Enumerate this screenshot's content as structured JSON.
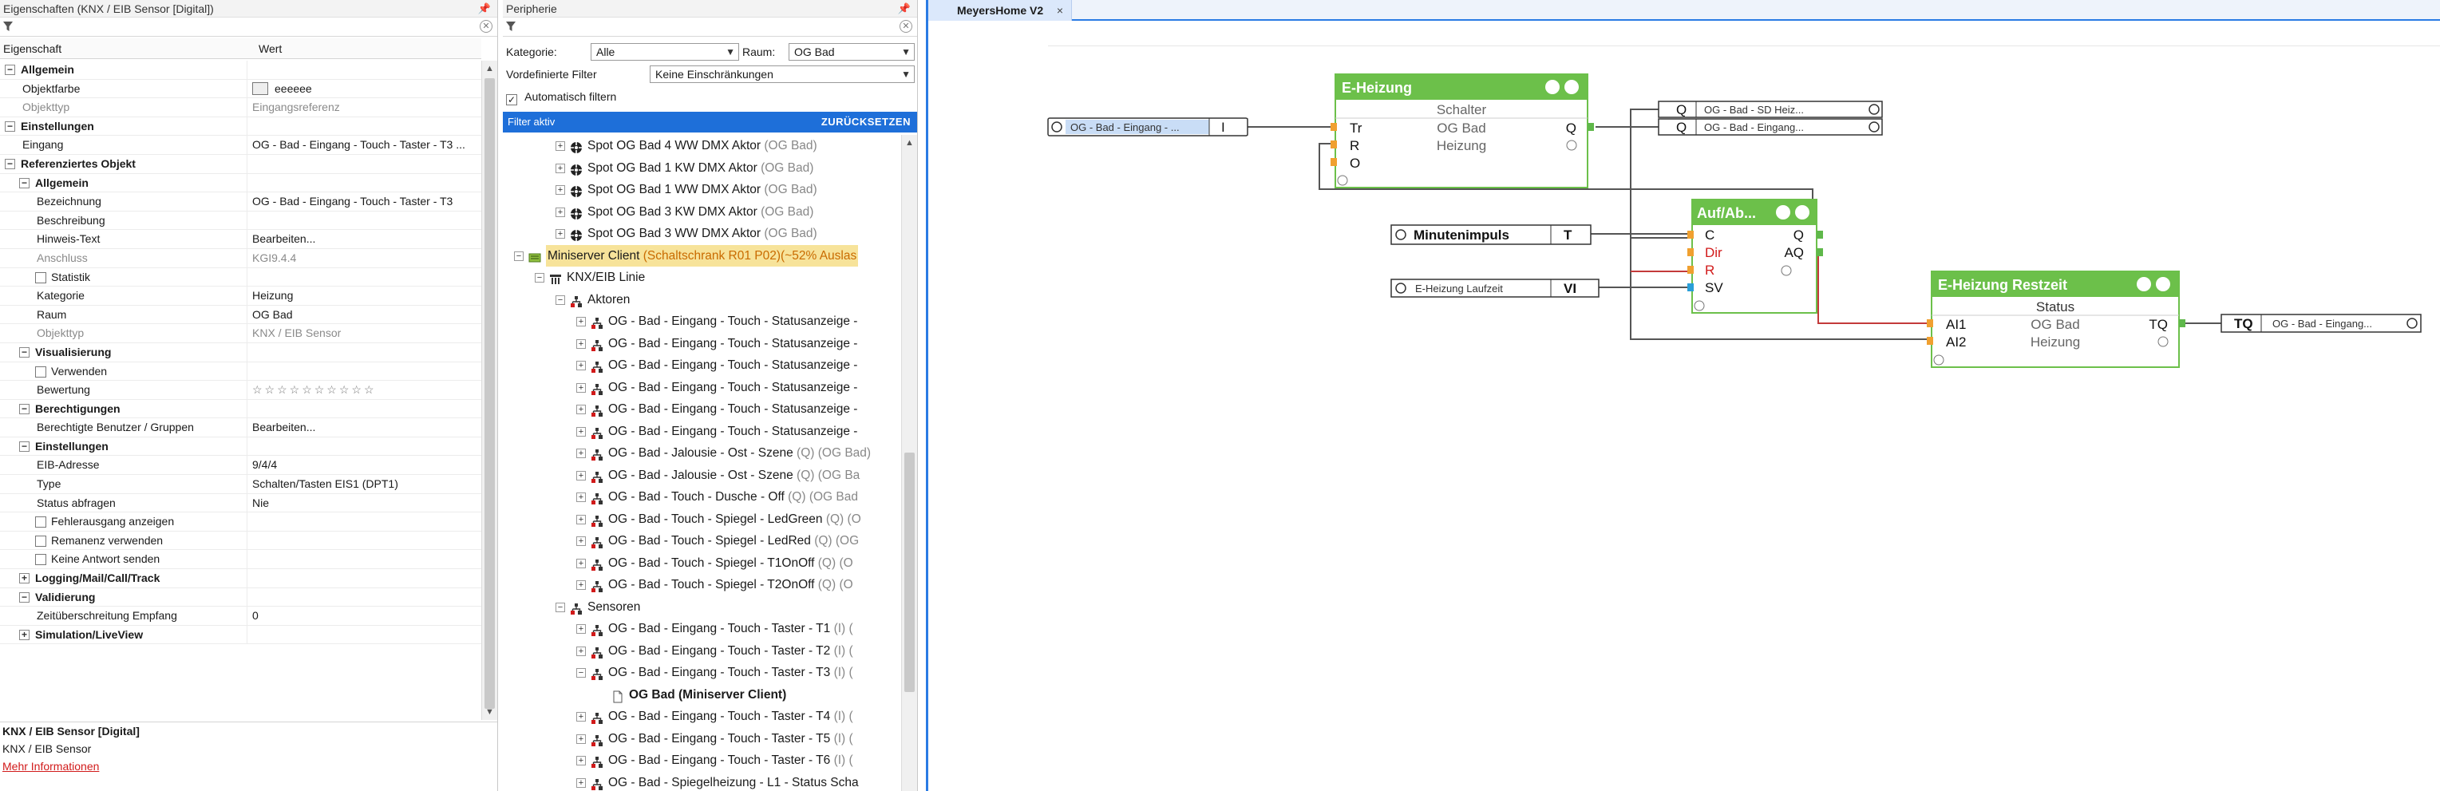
{
  "properties": {
    "title": "Eigenschaften (KNX / EIB Sensor [Digital])",
    "col_property": "Eigenschaft",
    "col_value": "Wert",
    "rows": [
      {
        "k": "Allgemein",
        "v": "",
        "level": 0,
        "cat": true,
        "toggle": "-"
      },
      {
        "k": "Objektfarbe",
        "v": "eeeeee",
        "level": 1,
        "swatch": true
      },
      {
        "k": "Objekttyp",
        "v": "Eingangsreferenz",
        "level": 1,
        "muted": true
      },
      {
        "k": "Einstellungen",
        "v": "",
        "level": 0,
        "cat": true,
        "toggle": "-"
      },
      {
        "k": "Eingang",
        "v": "OG - Bad - Eingang - Touch - Taster - T3 ...",
        "level": 1
      },
      {
        "k": "Referenziertes Objekt",
        "v": "",
        "level": 0,
        "cat": true,
        "toggle": "-"
      },
      {
        "k": "Allgemein",
        "v": "",
        "level": 1,
        "cat": true,
        "toggle": "-"
      },
      {
        "k": "Bezeichnung",
        "v": "OG - Bad - Eingang - Touch - Taster - T3",
        "level": 2
      },
      {
        "k": "Beschreibung",
        "v": "",
        "level": 2
      },
      {
        "k": "Hinweis-Text",
        "v": "Bearbeiten...",
        "level": 2
      },
      {
        "k": "Anschluss",
        "v": "KGI9.4.4",
        "level": 2,
        "muted": true
      },
      {
        "k": "Statistik",
        "v": "",
        "level": 2,
        "check": true
      },
      {
        "k": "Kategorie",
        "v": "Heizung",
        "level": 2
      },
      {
        "k": "Raum",
        "v": "OG Bad",
        "level": 2
      },
      {
        "k": "Objekttyp",
        "v": "KNX / EIB Sensor",
        "level": 2,
        "muted": true
      },
      {
        "k": "Visualisierung",
        "v": "",
        "level": 1,
        "cat": true,
        "toggle": "-"
      },
      {
        "k": "Verwenden",
        "v": "",
        "level": 2,
        "check": true
      },
      {
        "k": "Bewertung",
        "v": "☆☆☆☆☆☆☆☆☆☆",
        "level": 2,
        "stars": true
      },
      {
        "k": "Berechtigungen",
        "v": "",
        "level": 1,
        "cat": true,
        "toggle": "-"
      },
      {
        "k": "Berechtigte Benutzer / Gruppen",
        "v": "Bearbeiten...",
        "level": 2
      },
      {
        "k": "Einstellungen",
        "v": "",
        "level": 1,
        "cat": true,
        "toggle": "-"
      },
      {
        "k": "EIB-Adresse",
        "v": "9/4/4",
        "level": 2
      },
      {
        "k": "Type",
        "v": "Schalten/Tasten EIS1 (DPT1)",
        "level": 2
      },
      {
        "k": "Status abfragen",
        "v": "Nie",
        "level": 2
      },
      {
        "k": "Fehlerausgang anzeigen",
        "v": "",
        "level": 2,
        "check": true
      },
      {
        "k": "Remanenz verwenden",
        "v": "",
        "level": 2,
        "check": true
      },
      {
        "k": "Keine Antwort senden",
        "v": "",
        "level": 2,
        "check": true
      },
      {
        "k": "Logging/Mail/Call/Track",
        "v": "",
        "level": 1,
        "cat": true,
        "toggle": "+"
      },
      {
        "k": "Validierung",
        "v": "",
        "level": 1,
        "cat": true,
        "toggle": "-"
      },
      {
        "k": "Zeitüberschreitung Empfang",
        "v": "0",
        "level": 2
      },
      {
        "k": "Simulation/LiveView",
        "v": "",
        "level": 1,
        "cat": true,
        "toggle": "+"
      }
    ],
    "info": {
      "title": "KNX / EIB Sensor [Digital]",
      "subtitle": "KNX / EIB Sensor",
      "link": "Mehr Informationen"
    }
  },
  "periphery": {
    "title": "Peripherie",
    "kategorie_label": "Kategorie:",
    "kategorie_value": "Alle",
    "raum_label": "Raum:",
    "raum_value": "OG Bad",
    "filter_label": "Vordefinierte Filter",
    "filter_value": "Keine Einschränkungen",
    "auto_filter": "Automatisch filtern",
    "filter_active": "Filter aktiv",
    "reset": "ZURÜCKSETZEN",
    "tree": [
      {
        "t": "Spot OG Bad 4 WW DMX Aktor",
        "room": "(OG Bad)",
        "lvl": 2,
        "icon": "dmx"
      },
      {
        "t": "Spot OG Bad 1 KW DMX Aktor",
        "room": "(OG Bad)",
        "lvl": 2,
        "icon": "dmx"
      },
      {
        "t": "Spot OG Bad 1 WW DMX Aktor",
        "room": "(OG Bad)",
        "lvl": 2,
        "icon": "dmx"
      },
      {
        "t": "Spot OG Bad 3 KW DMX Aktor",
        "room": "(OG Bad)",
        "lvl": 2,
        "icon": "dmx"
      },
      {
        "t": "Spot OG Bad 3 WW DMX Aktor",
        "room": "(OG Bad)",
        "lvl": 2,
        "icon": "dmx"
      },
      {
        "t": "Miniserver Client",
        "room": "(Schaltschrank R01 P02)(~52% Auslas",
        "lvl": 0,
        "icon": "ms",
        "exp": "-",
        "hl": true
      },
      {
        "t": "KNX/EIB Linie",
        "room": "",
        "lvl": 1,
        "icon": "knx",
        "exp": "-"
      },
      {
        "t": "Aktoren",
        "room": "",
        "lvl": 2,
        "icon": "act",
        "exp": "-"
      },
      {
        "t": "OG - Bad - Eingang - Touch - Statusanzeige -",
        "room": "",
        "lvl": 3,
        "icon": "act"
      },
      {
        "t": "OG - Bad - Eingang - Touch - Statusanzeige -",
        "room": "",
        "lvl": 3,
        "icon": "act"
      },
      {
        "t": "OG - Bad - Eingang - Touch - Statusanzeige -",
        "room": "",
        "lvl": 3,
        "icon": "act"
      },
      {
        "t": "OG - Bad - Eingang - Touch - Statusanzeige -",
        "room": "",
        "lvl": 3,
        "icon": "act"
      },
      {
        "t": "OG - Bad - Eingang - Touch - Statusanzeige -",
        "room": "",
        "lvl": 3,
        "icon": "act"
      },
      {
        "t": "OG - Bad - Eingang - Touch - Statusanzeige -",
        "room": "",
        "lvl": 3,
        "icon": "act"
      },
      {
        "t": "OG - Bad - Jalousie - Ost - Szene",
        "room": "(Q) (OG Bad)",
        "lvl": 3,
        "icon": "act"
      },
      {
        "t": "OG - Bad - Jalousie - Ost - Szene",
        "room": "(Q) (OG Ba",
        "lvl": 3,
        "icon": "act"
      },
      {
        "t": "OG - Bad - Touch - Dusche - Off",
        "room": "(Q) (OG Bad",
        "lvl": 3,
        "icon": "act"
      },
      {
        "t": "OG - Bad - Touch - Spiegel - LedGreen",
        "room": "(Q) (O",
        "lvl": 3,
        "icon": "act"
      },
      {
        "t": "OG - Bad - Touch - Spiegel - LedRed",
        "room": "(Q) (OG",
        "lvl": 3,
        "icon": "act"
      },
      {
        "t": "OG - Bad - Touch - Spiegel - T1OnOff",
        "room": "(Q) (O",
        "lvl": 3,
        "icon": "act"
      },
      {
        "t": "OG - Bad - Touch - Spiegel - T2OnOff",
        "room": "(Q) (O",
        "lvl": 3,
        "icon": "act"
      },
      {
        "t": "Sensoren",
        "room": "",
        "lvl": 2,
        "icon": "act",
        "exp": "-"
      },
      {
        "t": "OG - Bad - Eingang - Touch - Taster - T1",
        "room": "(I) (",
        "lvl": 3,
        "icon": "act"
      },
      {
        "t": "OG - Bad - Eingang - Touch - Taster - T2",
        "room": "(I) (",
        "lvl": 3,
        "icon": "act"
      },
      {
        "t": "OG - Bad - Eingang - Touch - Taster - T3",
        "room": "(I) (",
        "lvl": 3,
        "icon": "act",
        "exp": "-"
      },
      {
        "t": "OG Bad (Miniserver Client)",
        "room": "",
        "lvl": 4,
        "icon": "doc",
        "bold": true
      },
      {
        "t": "OG - Bad - Eingang - Touch - Taster - T4",
        "room": "(I) (",
        "lvl": 3,
        "icon": "act"
      },
      {
        "t": "OG - Bad - Eingang - Touch - Taster - T5",
        "room": "(I) (",
        "lvl": 3,
        "icon": "act"
      },
      {
        "t": "OG - Bad - Eingang - Touch - Taster - T6",
        "room": "(I) (",
        "lvl": 3,
        "icon": "act"
      },
      {
        "t": "OG - Bad - Spiegelheizung - L1 - Status Scha",
        "room": "",
        "lvl": 3,
        "icon": "act"
      }
    ]
  },
  "canvas": {
    "tab": "MeyersHome V2",
    "tab_close": "×",
    "colors": {
      "block_header": "#6cc04a",
      "accent": "#2a7be4",
      "wire": "#c33a3a"
    },
    "input_ref": {
      "name": "OG - Bad - Eingang - ...",
      "port": "I"
    },
    "eheizung": {
      "title": "E-Heizung",
      "subtitle": "Schalter",
      "in_tr": "Tr",
      "in_r": "R",
      "in_o": "O",
      "out_q": "Q",
      "mid1": "OG Bad",
      "mid2": "Heizung"
    },
    "out_q1": {
      "port": "Q",
      "name": "OG - Bad - SD Heiz..."
    },
    "out_q2": {
      "port": "Q",
      "name": "OG - Bad - Eingang..."
    },
    "minuten": {
      "name": "Minutenimpuls",
      "port": "T"
    },
    "laufzeit": {
      "name": "E-Heizung Laufzeit",
      "port": "VI"
    },
    "aufab": {
      "title": "Auf/Ab...",
      "in_c": "C",
      "in_dir": "Dir",
      "in_r": "R",
      "in_sv": "SV",
      "out_q": "Q",
      "out_aq": "AQ"
    },
    "restzeit": {
      "title": "E-Heizung Restzeit",
      "subtitle": "Status",
      "in_ai1": "AI1",
      "in_ai2": "AI2",
      "out_tq": "TQ",
      "mid1": "OG Bad",
      "mid2": "Heizung"
    },
    "out_tq": {
      "port": "TQ",
      "name": "OG - Bad - Eingang..."
    }
  }
}
